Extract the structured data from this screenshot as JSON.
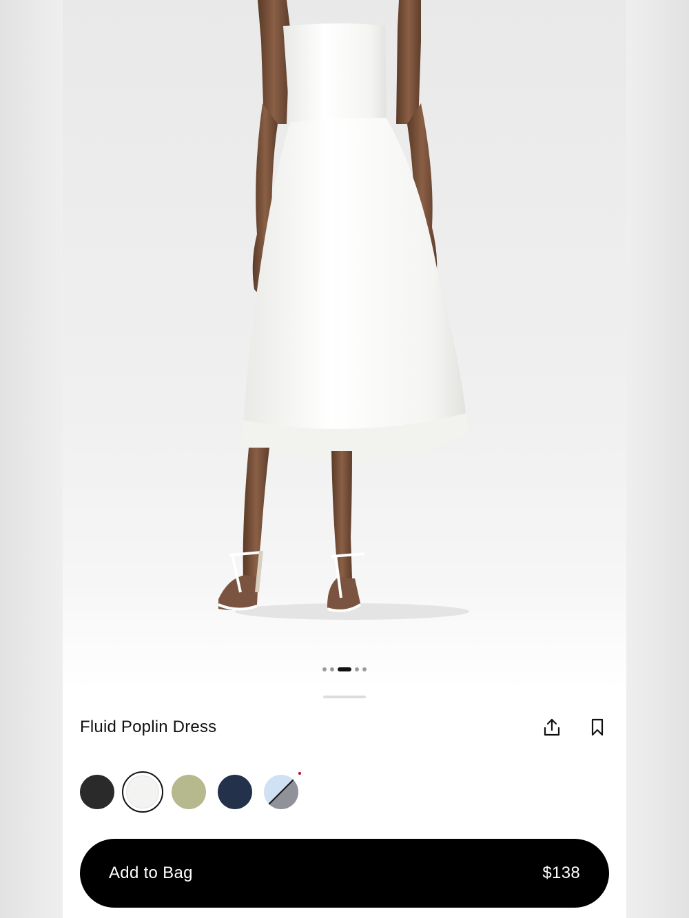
{
  "product": {
    "title": "Fluid Poplin Dress",
    "image_alt": "Model wearing white strapless poplin midi dress with white sandals",
    "gallery": {
      "count": 5,
      "active_index": 2
    }
  },
  "actions": {
    "share_icon": "share-icon",
    "bookmark_icon": "bookmark-icon"
  },
  "colors": [
    {
      "name": "black",
      "hex": "#2a2a2a",
      "selected": false
    },
    {
      "name": "white",
      "hex": "#f3f3f1",
      "selected": true
    },
    {
      "name": "sage",
      "hex": "#b6b88d",
      "selected": false
    },
    {
      "name": "navy",
      "hex": "#23324a",
      "selected": false
    },
    {
      "name": "light-blue-grey",
      "hex": "#cfe1f3",
      "hex2": "#8f9298",
      "selected": false,
      "unavailable": true
    }
  ],
  "cta": {
    "label": "Add to Bag",
    "price": "$138"
  }
}
